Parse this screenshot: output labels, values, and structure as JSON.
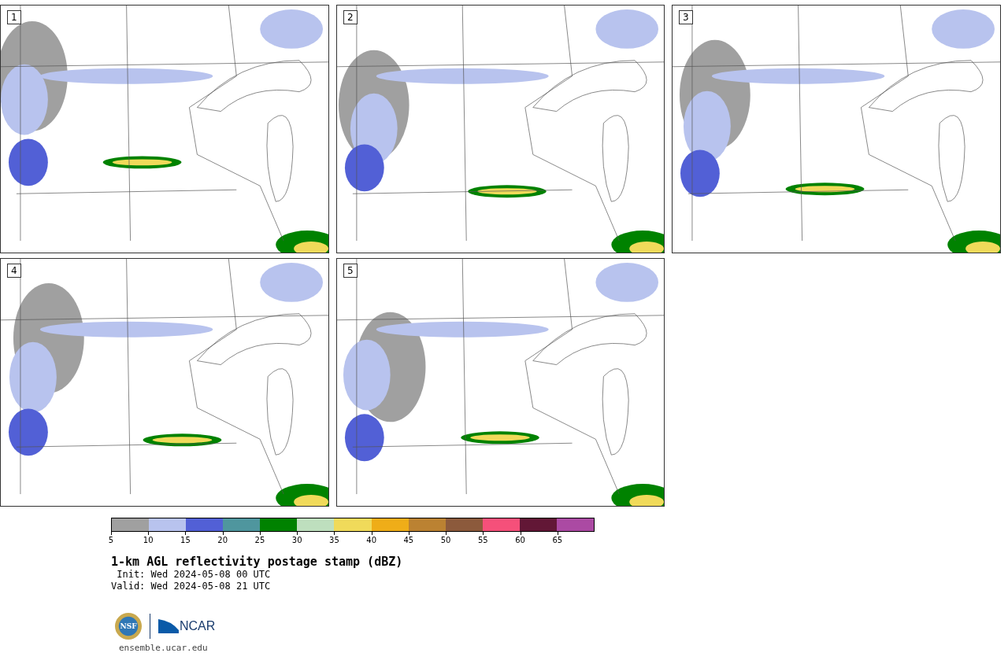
{
  "panels": [
    {
      "label": "1"
    },
    {
      "label": "2"
    },
    {
      "label": "3"
    },
    {
      "label": "4"
    },
    {
      "label": "5"
    }
  ],
  "colorbar": {
    "bins": [
      {
        "color": "#a0a0a0",
        "tick": "5"
      },
      {
        "color": "#b8c3ee",
        "tick": "10"
      },
      {
        "color": "#5260d6",
        "tick": "15"
      },
      {
        "color": "#4f969e",
        "tick": "20"
      },
      {
        "color": "#008200",
        "tick": "25"
      },
      {
        "color": "#bedfbe",
        "tick": "30"
      },
      {
        "color": "#f0da5a",
        "tick": "35"
      },
      {
        "color": "#efad18",
        "tick": "40"
      },
      {
        "color": "#bb8232",
        "tick": "45"
      },
      {
        "color": "#8c5a3c",
        "tick": "50"
      },
      {
        "color": "#f5507a",
        "tick": "55"
      },
      {
        "color": "#621736",
        "tick": "60"
      },
      {
        "color": "#ab4aa3",
        "tick": "65"
      }
    ]
  },
  "title": "1-km AGL reflectivity postage stamp (dBZ)",
  "init": " Init: Wed 2024-05-08 00 UTC",
  "valid": "Valid: Wed 2024-05-08 21 UTC",
  "logo": {
    "seal": "NSF",
    "wordmark": "NCAR"
  },
  "site": "ensemble.ucar.edu"
}
